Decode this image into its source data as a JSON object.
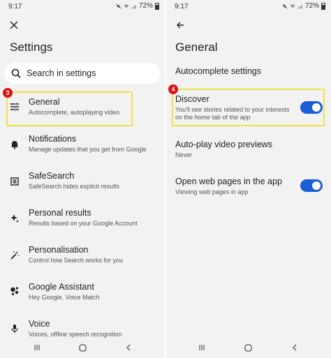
{
  "left_screen": {
    "status": {
      "time": "9:17",
      "battery": "72%"
    },
    "title": "Settings",
    "search": {
      "label": "Search in settings"
    },
    "items": [
      {
        "title": "General",
        "subtitle": "Autocomplete, autoplaying video",
        "icon": "sliders-icon"
      },
      {
        "title": "Notifications",
        "subtitle": "Manage updates that you get from Google",
        "icon": "bell-icon"
      },
      {
        "title": "SafeSearch",
        "subtitle": "SafeSearch hides explicit results",
        "icon": "safesearch-icon"
      },
      {
        "title": "Personal results",
        "subtitle": "Results based on your Google Account",
        "icon": "sparkle-icon"
      },
      {
        "title": "Personalisation",
        "subtitle": "Control how Search works for you",
        "icon": "magic-wand-icon"
      },
      {
        "title": "Google Assistant",
        "subtitle": "Hey Google, Voice Match",
        "icon": "assistant-icon"
      },
      {
        "title": "Voice",
        "subtitle": "Voices, offline speech recognition",
        "icon": "microphone-icon"
      }
    ],
    "step_badge": "3"
  },
  "right_screen": {
    "status": {
      "time": "9:17",
      "battery": "72%"
    },
    "title": "General",
    "section_header": "Autocomplete settings",
    "items": [
      {
        "title": "Discover",
        "subtitle": "You'll see stories related to your interests on the home tab of the app",
        "toggle": true
      },
      {
        "title": "Auto-play video previews",
        "subtitle": "Never"
      },
      {
        "title": "Open web pages in the app",
        "subtitle": "Viewing web pages in app",
        "toggle": true
      }
    ],
    "step_badge": "4"
  },
  "colors": {
    "accent": "#1a5fd6",
    "highlight": "#f0e24a",
    "badge": "#dd1111",
    "background": "#f2f2f2"
  }
}
